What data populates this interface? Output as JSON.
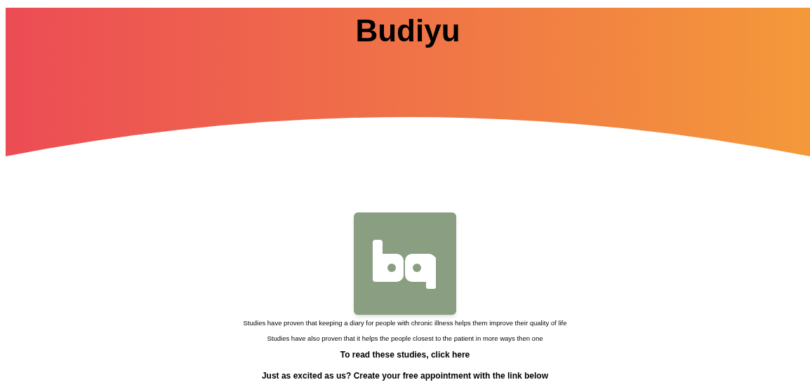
{
  "header": {
    "title": "Budiyu"
  },
  "intro": [
    "Studies have proven that keeping a diary for people with chronic illness helps them improve their quality of life",
    "Studies have also proven that it helps the people closest to the patient in more ways then one"
  ],
  "studies": {
    "text": "To read these studies, ",
    "link": "click here"
  },
  "cta": "Just as excited as us? Create your free appointment with the link below"
}
